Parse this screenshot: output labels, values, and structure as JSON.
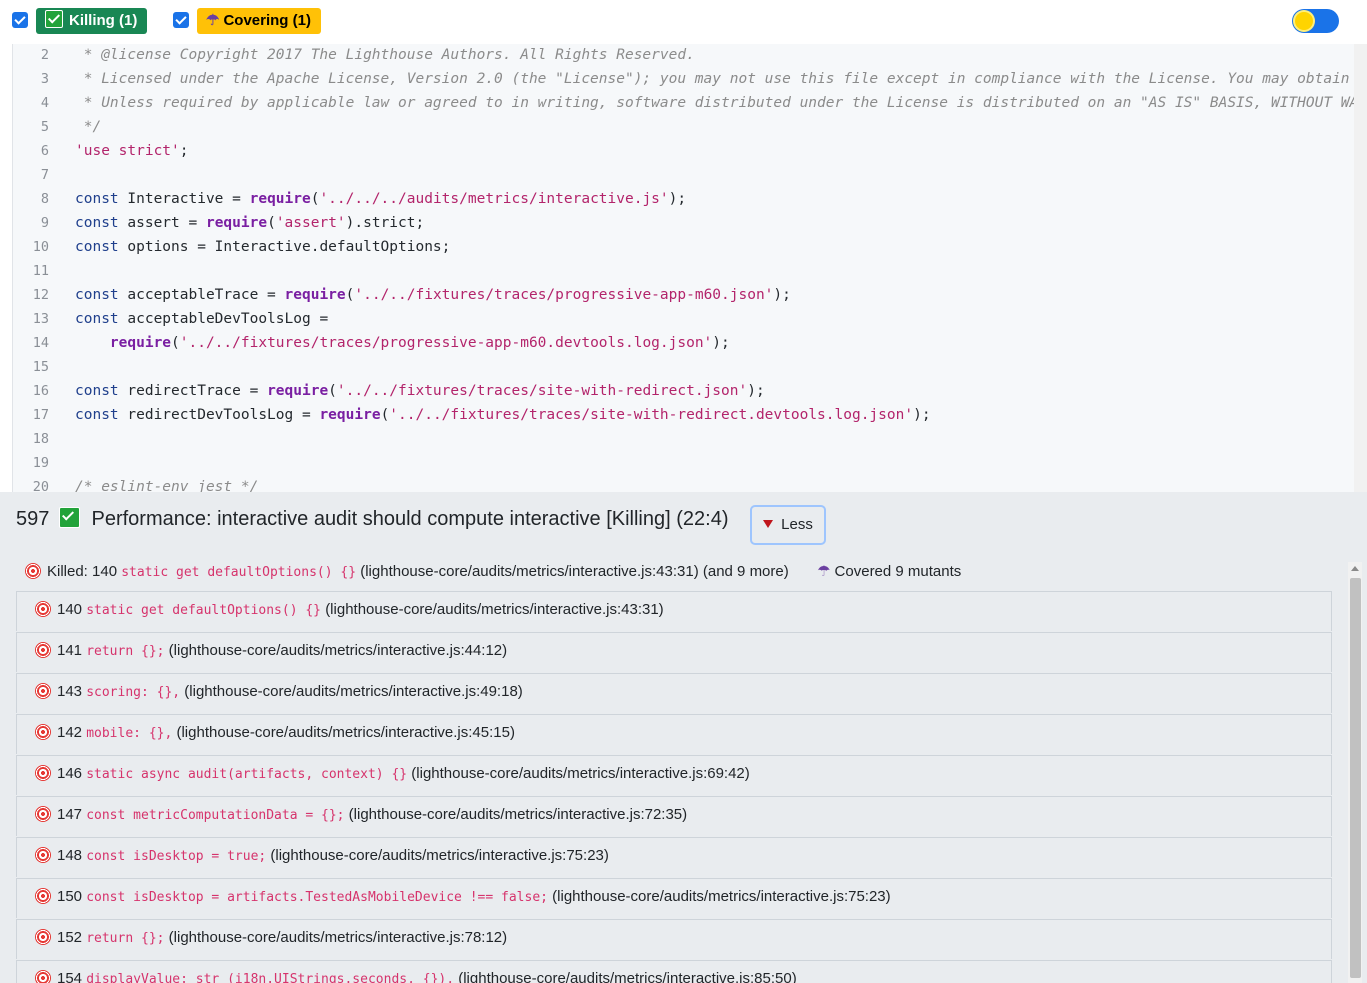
{
  "filters": {
    "killing_label": "Killing (1)",
    "covering_label": "Covering (1)"
  },
  "code_lines": [
    {
      "n": "2",
      "text": " * @license Copyright 2017 The Lighthouse Authors. All Rights Reserved."
    },
    {
      "n": "3",
      "text": " * Licensed under the Apache License, Version 2.0 (the \"License\"); you may not use this file except in compliance with the License. You may obtain"
    },
    {
      "n": "4",
      "text": " * Unless required by applicable law or agreed to in writing, software distributed under the License is distributed on an \"AS IS\" BASIS, WITHOUT WA"
    },
    {
      "n": "5",
      "text": " */"
    },
    {
      "n": "6",
      "text": "'use strict';"
    },
    {
      "n": "7",
      "text": ""
    },
    {
      "n": "8",
      "text": "const Interactive = require('../../../audits/metrics/interactive.js');"
    },
    {
      "n": "9",
      "text": "const assert = require('assert').strict;"
    },
    {
      "n": "10",
      "text": "const options = Interactive.defaultOptions;"
    },
    {
      "n": "11",
      "text": ""
    },
    {
      "n": "12",
      "text": "const acceptableTrace = require('../../fixtures/traces/progressive-app-m60.json');"
    },
    {
      "n": "13",
      "text": "const acceptableDevToolsLog ="
    },
    {
      "n": "14",
      "text": "    require('../../fixtures/traces/progressive-app-m60.devtools.log.json');"
    },
    {
      "n": "15",
      "text": ""
    },
    {
      "n": "16",
      "text": "const redirectTrace = require('../../fixtures/traces/site-with-redirect.json');"
    },
    {
      "n": "17",
      "text": "const redirectDevToolsLog = require('../../fixtures/traces/site-with-redirect.devtools.log.json');"
    },
    {
      "n": "18",
      "text": ""
    },
    {
      "n": "19",
      "text": ""
    },
    {
      "n": "20",
      "text": "/* eslint-env jest */"
    }
  ],
  "test": {
    "id": "597",
    "name": "Performance: interactive audit should compute interactive [Killing] (22:4)",
    "less_label": "Less"
  },
  "summary": {
    "killed_prefix": "Killed: 140",
    "killed_code": "static get defaultOptions() {}",
    "killed_loc": "(lighthouse-core/audits/metrics/interactive.js:43:31) (and 9 more)",
    "covered_label": "Covered 9 mutants"
  },
  "mutants": [
    {
      "id": "140",
      "code": "static get defaultOptions() {}",
      "loc": "(lighthouse-core/audits/metrics/interactive.js:43:31)"
    },
    {
      "id": "141",
      "code": "return {};",
      "loc": "(lighthouse-core/audits/metrics/interactive.js:44:12)"
    },
    {
      "id": "143",
      "code": "scoring: {},",
      "loc": "(lighthouse-core/audits/metrics/interactive.js:49:18)"
    },
    {
      "id": "142",
      "code": "mobile: {},",
      "loc": "(lighthouse-core/audits/metrics/interactive.js:45:15)"
    },
    {
      "id": "146",
      "code": "static async audit(artifacts, context) {}",
      "loc": "(lighthouse-core/audits/metrics/interactive.js:69:42)"
    },
    {
      "id": "147",
      "code": "const metricComputationData = {};",
      "loc": "(lighthouse-core/audits/metrics/interactive.js:72:35)"
    },
    {
      "id": "148",
      "code": "const isDesktop = true;",
      "loc": "(lighthouse-core/audits/metrics/interactive.js:75:23)"
    },
    {
      "id": "150",
      "code": "const isDesktop = artifacts.TestedAsMobileDevice !== false;",
      "loc": "(lighthouse-core/audits/metrics/interactive.js:75:23)"
    },
    {
      "id": "152",
      "code": "return {};",
      "loc": "(lighthouse-core/audits/metrics/interactive.js:78:12)"
    },
    {
      "id": "154",
      "code": "displayValue: str_(i18n.UIStrings.seconds, {}),",
      "loc": "(lighthouse-core/audits/metrics/interactive.js:85:50)"
    }
  ]
}
